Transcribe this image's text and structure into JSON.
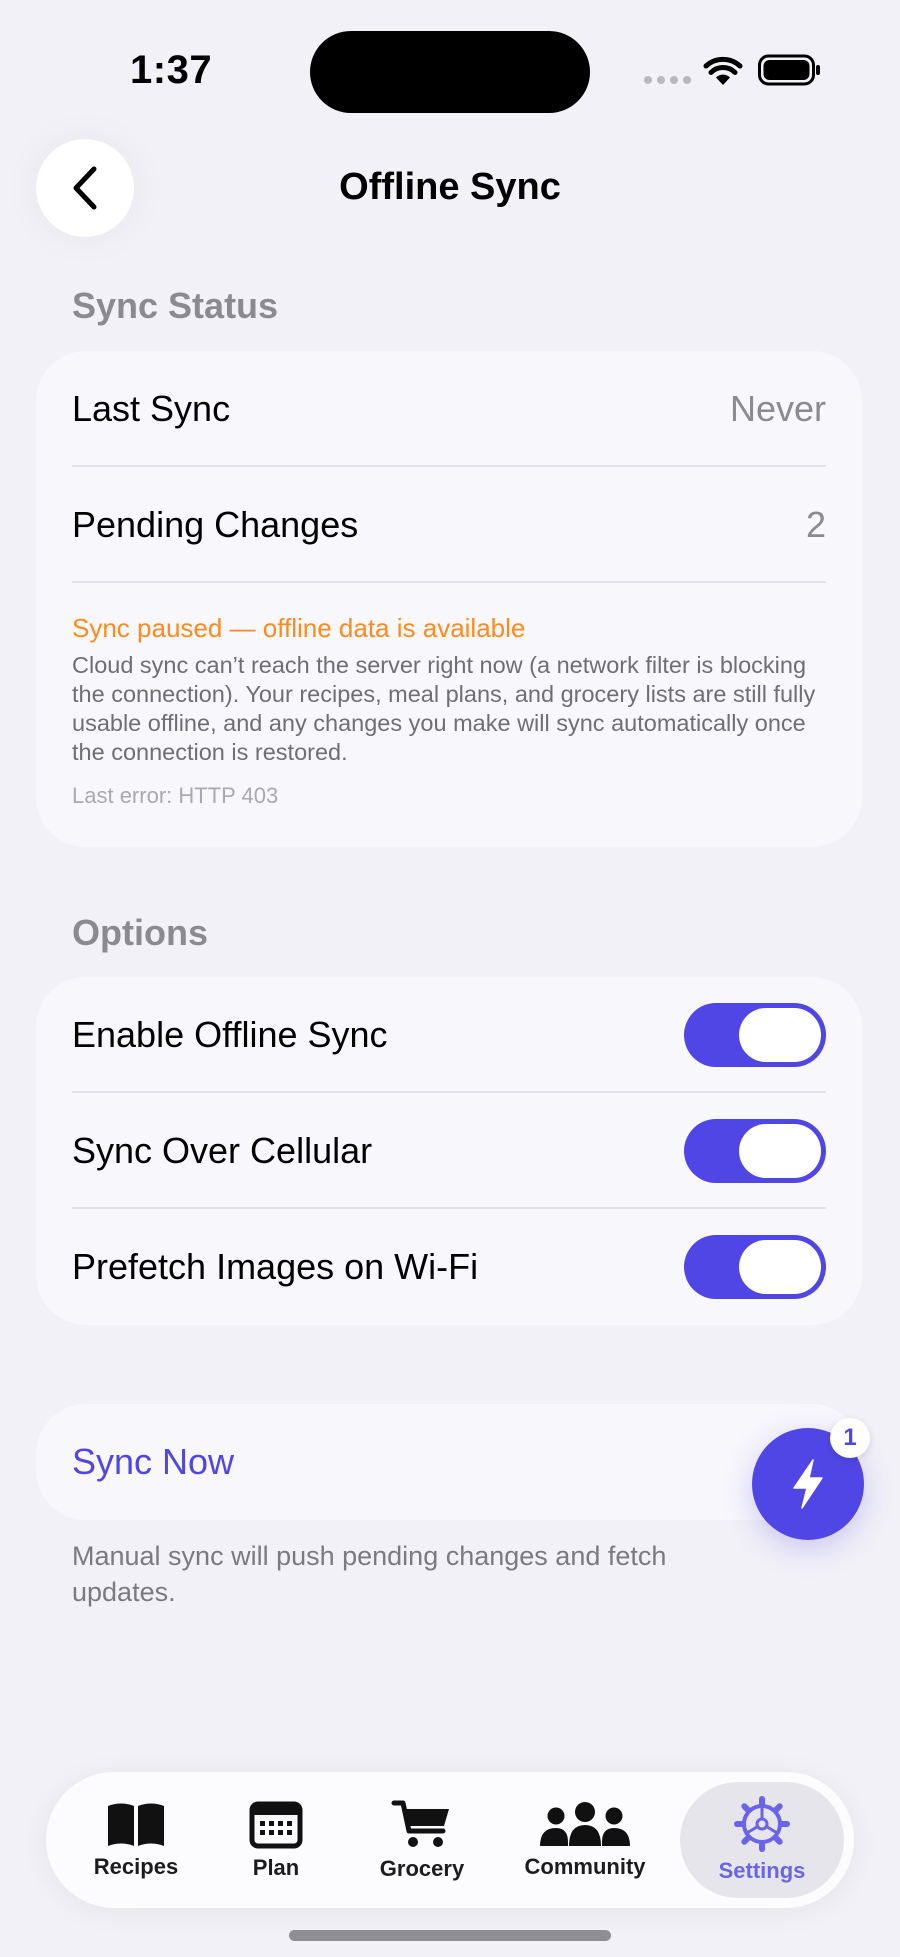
{
  "status_bar": {
    "time": "1:37"
  },
  "nav": {
    "title": "Offline Sync",
    "back_icon": "chevron-left-icon"
  },
  "sync_status": {
    "header": "Sync Status",
    "last_sync_label": "Last Sync",
    "last_sync_value": "Never",
    "pending_label": "Pending Changes",
    "pending_value": "2",
    "alert_title": "Sync paused — offline data is available",
    "alert_body": "Cloud sync can’t reach the server right now (a network filter is blocking the connection). Your recipes, meal plans, and grocery lists are still fully usable offline, and any changes you make will sync automatically once the connection is restored.",
    "alert_error": "Last error: HTTP 403"
  },
  "options": {
    "header": "Options",
    "items": [
      {
        "label": "Enable Offline Sync",
        "on": true
      },
      {
        "label": "Sync Over Cellular",
        "on": true
      },
      {
        "label": "Prefetch Images on Wi-Fi",
        "on": true
      }
    ]
  },
  "sync_now": {
    "label": "Sync Now",
    "footnote": "Manual sync will push pending changes and fetch updates."
  },
  "fab": {
    "icon": "bolt-icon",
    "badge": "1"
  },
  "tabs": [
    {
      "label": "Recipes",
      "icon": "book-icon",
      "active": false
    },
    {
      "label": "Plan",
      "icon": "calendar-icon",
      "active": false
    },
    {
      "label": "Grocery",
      "icon": "cart-icon",
      "active": false
    },
    {
      "label": "Community",
      "icon": "people-icon",
      "active": false
    },
    {
      "label": "Settings",
      "icon": "gear-icon",
      "active": true
    }
  ],
  "colors": {
    "accent": "#5046E5",
    "warning": "#FF8A1E",
    "background": "#F2F1F7",
    "card": "#F8F7FC",
    "secondary_text": "#8A8A8F"
  }
}
